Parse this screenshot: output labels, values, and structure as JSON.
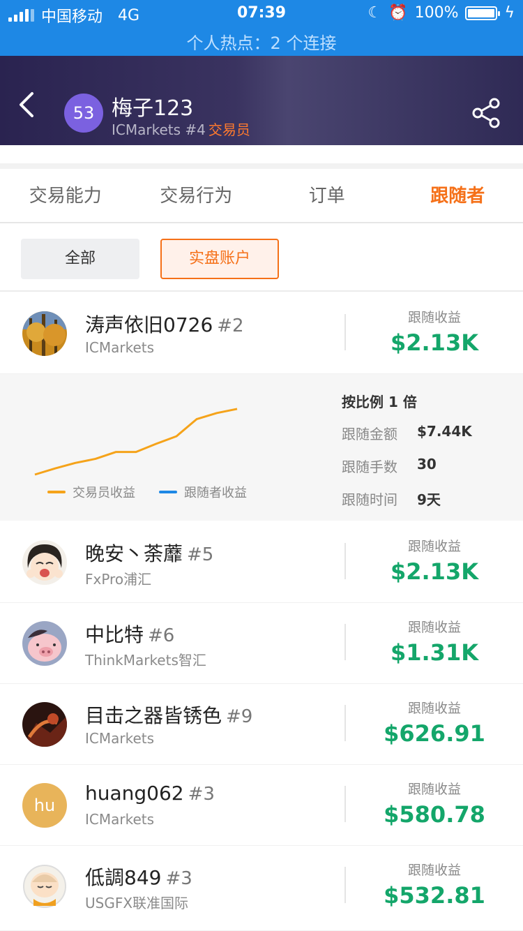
{
  "status_bar": {
    "carrier": "中国移动",
    "network": "4G",
    "time": "07:39",
    "battery": "100%",
    "hotspot": "个人热点：2 个连接"
  },
  "header": {
    "level": "53",
    "name": "梅子123",
    "broker": "ICMarkets #4",
    "role": "交易员"
  },
  "tabs": [
    {
      "label": "交易能力"
    },
    {
      "label": "交易行为"
    },
    {
      "label": "订单"
    },
    {
      "label": "跟随者"
    }
  ],
  "filter": {
    "all": "全部",
    "real": "实盘账户"
  },
  "followers": [
    {
      "name": "涛声依旧0726",
      "rank": "#2",
      "broker": "ICMarkets",
      "label": "跟随收益",
      "value": "$2.13K"
    },
    {
      "name": "晚安丶荼蘼",
      "rank": "#5",
      "broker": "FxPro浦汇",
      "label": "跟随收益",
      "value": "$2.13K"
    },
    {
      "name": "中比特",
      "rank": "#6",
      "broker": "ThinkMarkets智汇",
      "label": "跟随收益",
      "value": "$1.31K"
    },
    {
      "name": "目击之器皆锈色",
      "rank": "#9",
      "broker": "ICMarkets",
      "label": "跟随收益",
      "value": "$626.91"
    },
    {
      "name": "huang062",
      "rank": "#3",
      "broker": "ICMarkets",
      "label": "跟随收益",
      "value": "$580.78",
      "avatar_text": "hu"
    },
    {
      "name": "低調849",
      "rank": "#3",
      "broker": "USGFX联准国际",
      "label": "跟随收益",
      "value": "$532.81"
    }
  ],
  "detail": {
    "ratio": "按比例 1 倍",
    "amount_label": "跟随金额",
    "amount": "$7.44K",
    "lots_label": "跟随手数",
    "lots": "30",
    "time_label": "跟随时间",
    "time": "9天",
    "legend_trader": "交易员收益",
    "legend_follower": "跟随者收益"
  },
  "chart_data": {
    "type": "line",
    "series": [
      {
        "name": "交易员收益",
        "color": "#f5a31a",
        "values": [
          0.0,
          0.09,
          0.17,
          0.23,
          0.33,
          0.33,
          0.45,
          0.56,
          0.81,
          0.9,
          0.96
        ]
      },
      {
        "name": "跟随者收益",
        "color": "#1e88e5",
        "values": []
      }
    ],
    "grid": false
  },
  "colors": {
    "accent": "#f57018",
    "profit": "#14a66a",
    "status_bar": "#1e88e5"
  }
}
